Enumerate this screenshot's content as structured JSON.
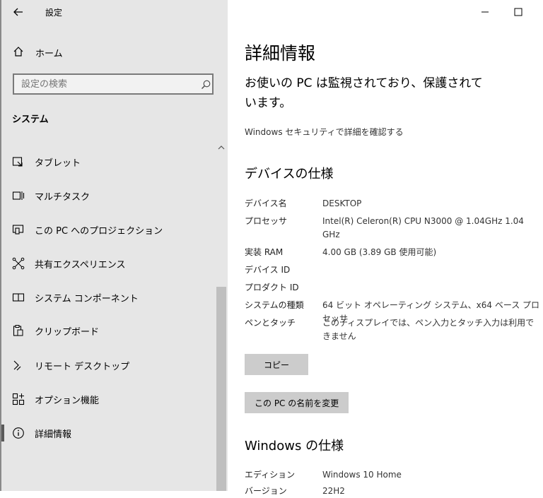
{
  "window": {
    "title": "設定",
    "controls": {
      "minimize_icon": "minimize-icon",
      "maximize_icon": "maximize-icon"
    }
  },
  "sidebar": {
    "home_label": "ホーム",
    "search_placeholder": "設定の検索",
    "section_title": "システム",
    "items": [
      {
        "label": "タブレット",
        "icon": "tablet-icon"
      },
      {
        "label": "マルチタスク",
        "icon": "multitask-icon"
      },
      {
        "label": "この PC へのプロジェクション",
        "icon": "projection-icon"
      },
      {
        "label": "共有エクスペリエンス",
        "icon": "shared-experience-icon"
      },
      {
        "label": "システム コンポーネント",
        "icon": "system-components-icon"
      },
      {
        "label": "クリップボード",
        "icon": "clipboard-icon"
      },
      {
        "label": "リモート デスクトップ",
        "icon": "remote-desktop-icon"
      },
      {
        "label": "オプション機能",
        "icon": "optional-features-icon"
      },
      {
        "label": "詳細情報",
        "icon": "info-icon",
        "selected": true
      }
    ]
  },
  "main": {
    "title": "詳細情報",
    "status": "お使いの PC は監視されており、保護されています。",
    "security_link": "Windows セキュリティで詳細を確認する",
    "device_spec_title": "デバイスの仕様",
    "device_specs": [
      {
        "key": "デバイス名",
        "value": "DESKTOP"
      },
      {
        "key": "プロセッサ",
        "value": "Intel(R) Celeron(R) CPU  N3000  @ 1.04GHz   1.04 GHz"
      },
      {
        "key": "実装 RAM",
        "value": "4.00 GB (3.89 GB 使用可能)"
      },
      {
        "key": "デバイス ID",
        "value": ""
      },
      {
        "key": "プロダクト ID",
        "value": ""
      },
      {
        "key": "システムの種類",
        "value": "64 ビット オペレーティング システム、x64 ベース プロセッサ"
      },
      {
        "key": "ペンとタッチ",
        "value": "このディスプレイでは、ペン入力とタッチ入力は利用できません"
      }
    ],
    "copy_button": "コピー",
    "rename_button": "この PC の名前を変更",
    "windows_spec_title": "Windows の仕様",
    "windows_specs": [
      {
        "key": "エディション",
        "value": "Windows 10 Home"
      },
      {
        "key": "バージョン",
        "value": "22H2"
      }
    ]
  }
}
